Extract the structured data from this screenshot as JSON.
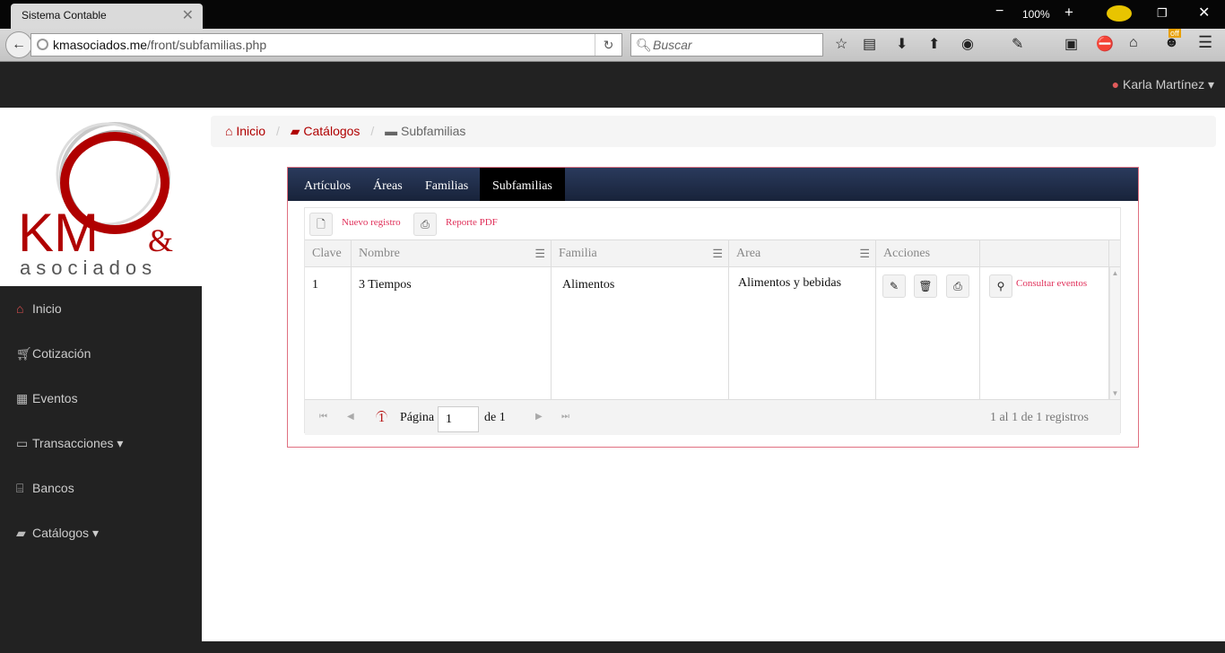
{
  "browser": {
    "tab_title": "Sistema Contable",
    "zoom": "100%",
    "url_host": "kmasociados.me",
    "url_path": "/front/subfamilias.php",
    "search_placeholder": "Buscar",
    "off_badge": "off"
  },
  "header": {
    "user_name": "Karla Martínez"
  },
  "logo": {
    "text_km": "KM",
    "text_amp": "&",
    "text_asociados": "asociados"
  },
  "sidebar": {
    "items": [
      {
        "label": "Inicio",
        "icon": "home-icon"
      },
      {
        "label": "Cotización",
        "icon": "cart-icon"
      },
      {
        "label": "Eventos",
        "icon": "calendar-icon"
      },
      {
        "label": "Transacciones",
        "icon": "money-icon"
      },
      {
        "label": "Bancos",
        "icon": "bank-icon"
      },
      {
        "label": "Catálogos",
        "icon": "book-icon"
      }
    ]
  },
  "breadcrumb": {
    "home": "Inicio",
    "catalogs": "Catálogos",
    "current": "Subfamilias"
  },
  "tabs": [
    "Artículos",
    "Áreas",
    "Familias",
    "Subfamilias"
  ],
  "toolbar": {
    "new_record": "Nuevo registro",
    "pdf_report": "Reporte PDF"
  },
  "grid": {
    "columns": [
      "Clave",
      "Nombre",
      "Familia",
      "Area",
      "Acciones",
      ""
    ],
    "rows": [
      {
        "clave": "1",
        "nombre": "3 Tiempos",
        "familia": "Alimentos",
        "area": "Alimentos y bebidas",
        "consult": "Consultar eventos"
      }
    ]
  },
  "pager": {
    "current_page": "1",
    "page_label": "Página",
    "page_value": "1",
    "of_label": "de 1",
    "summary": "1 al 1 de 1 registros"
  },
  "colors": {
    "accent": "#b00000",
    "link_pink": "#e0305a",
    "tab_bar": "#1f2c47",
    "dark_bg": "#222222"
  }
}
